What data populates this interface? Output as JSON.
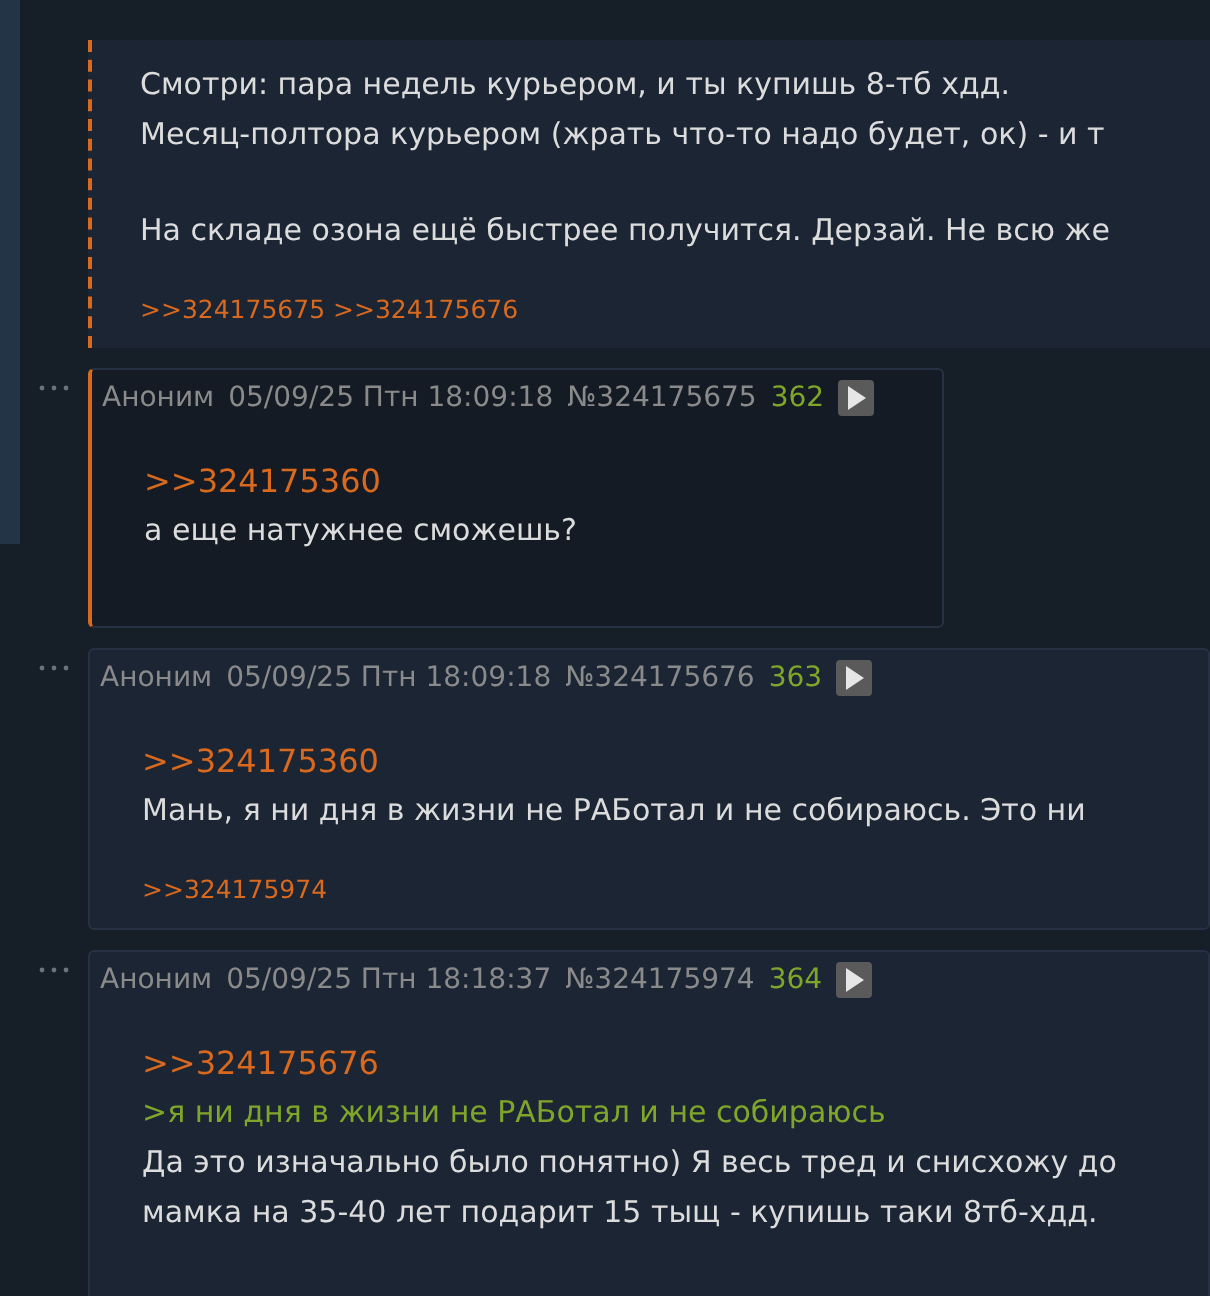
{
  "posts": [
    {
      "kind": "dashed",
      "paragraphs": [
        [
          {
            "kind": "text",
            "text": "Смотри: пара недель курьером, и ты купишь 8-тб хдд."
          },
          {
            "kind": "text",
            "text": "Месяц-полтора курьером (жрать что-то надо будет, ок) - и т"
          }
        ],
        [
          {
            "kind": "text",
            "text": "На складе озона ещё быстрее получится. Дерзай. Не всю же"
          }
        ]
      ],
      "replies": [
        ">>324175675",
        ">>324175676"
      ]
    },
    {
      "kind": "highlighted",
      "author": "Аноним",
      "date": "05/09/25 Птн 18:09:18",
      "number": "№324175675",
      "count": "362",
      "paragraphs": [
        [
          {
            "kind": "link",
            "text": ">>324175360"
          },
          {
            "kind": "text",
            "text": "а еще натужнее сможешь?"
          }
        ]
      ]
    },
    {
      "kind": "plain",
      "author": "Аноним",
      "date": "05/09/25 Птн 18:09:18",
      "number": "№324175676",
      "count": "363",
      "paragraphs": [
        [
          {
            "kind": "link",
            "text": ">>324175360"
          },
          {
            "kind": "text",
            "text": "Мань, я ни дня в жизни не РАБотал и не собираюсь. Это ни"
          }
        ]
      ],
      "replies": [
        ">>324175974"
      ]
    },
    {
      "kind": "plain",
      "author": "Аноним",
      "date": "05/09/25 Птн 18:18:37",
      "number": "№324175974",
      "count": "364",
      "paragraphs": [
        [
          {
            "kind": "link",
            "text": ">>324175676"
          },
          {
            "kind": "quote",
            "text": ">я ни дня в жизни не РАБотал и не собираюсь"
          },
          {
            "kind": "text",
            "text": "Да это изначально было понятно) Я весь тред и снисхожу до"
          },
          {
            "kind": "text",
            "text": "мамка на 35-40 лет подарит 15 тыщ - купишь таки 8тб-хдд."
          }
        ]
      ]
    }
  ]
}
